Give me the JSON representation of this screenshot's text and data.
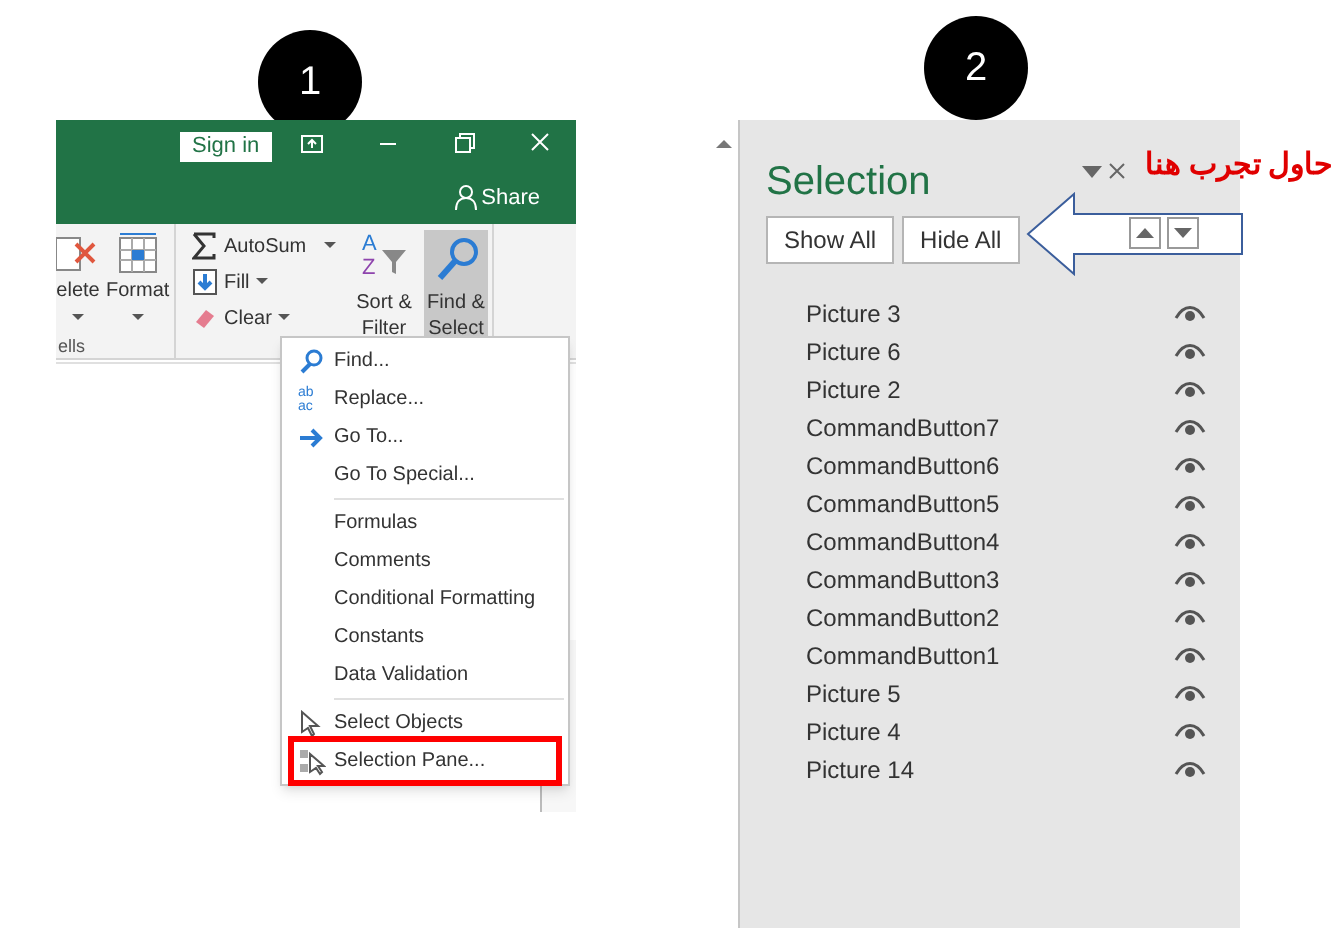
{
  "callouts": [
    "1",
    "2"
  ],
  "excel": {
    "title_bar": {
      "sign_in": "Sign in",
      "share": "Share"
    },
    "cells_group": {
      "buttons": [
        "elete",
        "Format"
      ],
      "label": "ells"
    },
    "editing_group": {
      "small_buttons": [
        {
          "label": "AutoSum",
          "kind": "sum"
        },
        {
          "label": "Fill",
          "kind": "fill"
        },
        {
          "label": "Clear",
          "kind": "clear"
        }
      ],
      "large_buttons": [
        {
          "label": "Sort & Filter",
          "kind": "sort",
          "selected": false,
          "icon_letters": [
            "A",
            "Z"
          ]
        },
        {
          "label": "Find & Select",
          "kind": "find",
          "selected": true
        }
      ]
    },
    "menu": [
      [
        {
          "label": "Find...",
          "kind": "find",
          "highlighted": false
        },
        {
          "label": "Replace...",
          "kind": "replace",
          "highlighted": false,
          "icon_letters": [
            "ab",
            "ac"
          ]
        },
        {
          "label": "Go To...",
          "kind": "goto",
          "highlighted": false
        },
        {
          "label": "Go To Special...",
          "kind": "none",
          "highlighted": false
        }
      ],
      [
        {
          "label": "Formulas",
          "kind": "none",
          "highlighted": false
        },
        {
          "label": "Comments",
          "kind": "none",
          "highlighted": false
        },
        {
          "label": "Conditional Formatting",
          "kind": "none",
          "highlighted": false
        },
        {
          "label": "Constants",
          "kind": "none",
          "highlighted": false
        },
        {
          "label": "Data Validation",
          "kind": "none",
          "highlighted": false
        }
      ],
      [
        {
          "label": "Select Objects",
          "kind": "pointer",
          "highlighted": false
        },
        {
          "label": "Selection Pane...",
          "kind": "pane",
          "highlighted": true
        }
      ]
    ]
  },
  "selection_pane": {
    "title": "Selection",
    "annotation": "حاول تجرب هنا",
    "buttons": [
      "Show All",
      "Hide All"
    ],
    "items": [
      {
        "name": "Picture 3",
        "visible": true
      },
      {
        "name": "Picture 6",
        "visible": true
      },
      {
        "name": "Picture 2",
        "visible": true
      },
      {
        "name": "CommandButton7",
        "visible": true
      },
      {
        "name": "CommandButton6",
        "visible": true
      },
      {
        "name": "CommandButton5",
        "visible": true
      },
      {
        "name": "CommandButton4",
        "visible": true
      },
      {
        "name": "CommandButton3",
        "visible": true
      },
      {
        "name": "CommandButton2",
        "visible": true
      },
      {
        "name": "CommandButton1",
        "visible": true
      },
      {
        "name": "Picture 5",
        "visible": true
      },
      {
        "name": "Picture 4",
        "visible": true
      },
      {
        "name": "Picture 14",
        "visible": true
      }
    ]
  }
}
